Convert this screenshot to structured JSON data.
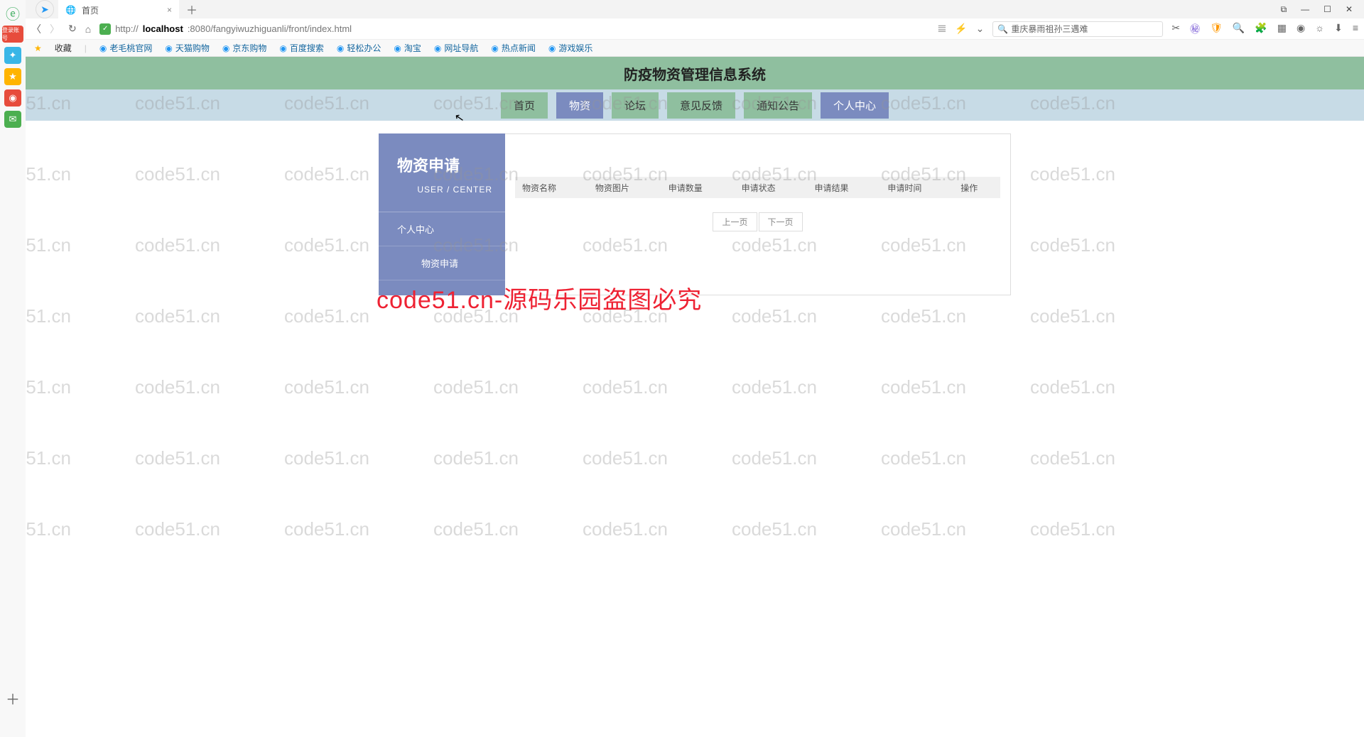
{
  "tab": {
    "title": "首页"
  },
  "url": {
    "prefix": "http://",
    "host": "localhost",
    "rest": ":8080/fangyiwuzhiguanli/front/index.html"
  },
  "search": {
    "placeholder": "重庆暴雨祖孙三遇难"
  },
  "bookmarks": {
    "fav": "收藏",
    "items": [
      "老毛桃官网",
      "天猫购物",
      "京东购物",
      "百度搜索",
      "轻松办公",
      "淘宝",
      "网址导航",
      "热点新闻",
      "游戏娱乐"
    ]
  },
  "banner": "防疫物资管理信息系统",
  "nav": [
    "首页",
    "物资",
    "论坛",
    "意见反馈",
    "通知公告",
    "个人中心"
  ],
  "side": {
    "title": "物资申请",
    "sub": "USER / CENTER",
    "items": [
      "个人中心",
      "物资申请"
    ]
  },
  "table": {
    "cols": [
      "物资名称",
      "物资图片",
      "申请数量",
      "申请状态",
      "申请结果",
      "申请时间",
      "操作"
    ]
  },
  "pager": {
    "prev": "上一页",
    "next": "下一页"
  },
  "watermark_text": "code51.cn",
  "big_watermark": "code51.cn-源码乐园盗图必究"
}
